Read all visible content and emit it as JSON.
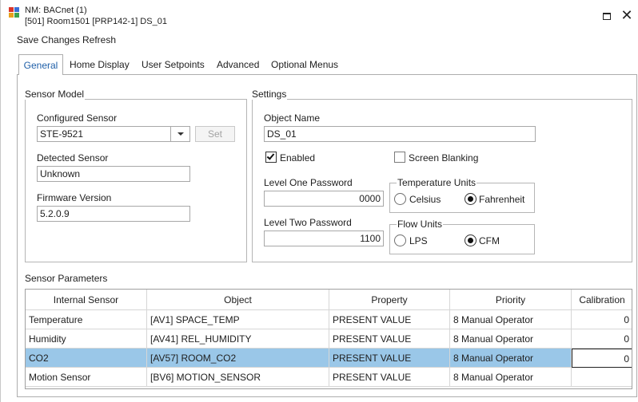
{
  "window": {
    "title_line1": "NM: BACnet (1)",
    "title_line2": "[501] Room1501 [PRP142-1] DS_01",
    "app_icon": "network-device-icon",
    "maximize_icon": "maximize-icon",
    "close_icon": "close-icon",
    "close_glyph": "✕"
  },
  "menu": {
    "save_changes": "Save Changes",
    "refresh": "Refresh"
  },
  "tabs": [
    {
      "label": "General",
      "active": true
    },
    {
      "label": "Home Display"
    },
    {
      "label": "User Setpoints"
    },
    {
      "label": "Advanced"
    },
    {
      "label": "Optional Menus"
    }
  ],
  "sensor_model": {
    "title": "Sensor Model",
    "configured_sensor_label": "Configured Sensor",
    "configured_sensor_value": "STE-9521",
    "set_button": "Set",
    "detected_sensor_label": "Detected Sensor",
    "detected_sensor_value": "Unknown",
    "firmware_label": "Firmware Version",
    "firmware_value": "5.2.0.9"
  },
  "settings": {
    "title": "Settings",
    "object_name_label": "Object Name",
    "object_name_value": "DS_01",
    "enabled_label": "Enabled",
    "enabled_checked": true,
    "screen_blanking_label": "Screen Blanking",
    "screen_blanking_checked": false,
    "level_one_label": "Level One Password",
    "level_one_value": "0000",
    "level_two_label": "Level Two Password",
    "level_two_value": "1100",
    "temperature_units": {
      "title": "Temperature Units",
      "options": [
        "Celsius",
        "Fahrenheit"
      ],
      "selected": "Fahrenheit"
    },
    "flow_units": {
      "title": "Flow Units",
      "options": [
        "LPS",
        "CFM"
      ],
      "selected": "CFM"
    }
  },
  "sensor_parameters": {
    "title": "Sensor Parameters",
    "columns": [
      "Internal Sensor",
      "Object",
      "Property",
      "Priority",
      "Calibration"
    ],
    "rows": [
      {
        "sensor": "Temperature",
        "object": "[AV1] SPACE_TEMP",
        "property": "PRESENT VALUE",
        "priority": "8 Manual Operator",
        "calibration": "0"
      },
      {
        "sensor": "Humidity",
        "object": "[AV41] REL_HUMIDITY",
        "property": "PRESENT VALUE",
        "priority": "8 Manual Operator",
        "calibration": "0"
      },
      {
        "sensor": "CO2",
        "object": "[AV57] ROOM_CO2",
        "property": "PRESENT VALUE",
        "priority": "8 Manual Operator",
        "calibration": "0",
        "selected": true
      },
      {
        "sensor": "Motion Sensor",
        "object": "[BV6] MOTION_SENSOR",
        "property": "PRESENT VALUE",
        "priority": "8 Manual Operator",
        "calibration": ""
      }
    ]
  },
  "colors": {
    "selection": "#9ac7e8",
    "active_tab_text": "#1f5fa8"
  }
}
